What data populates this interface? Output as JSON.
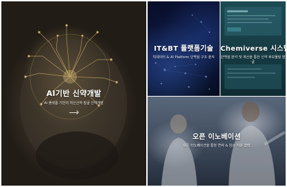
{
  "panels": {
    "ai": {
      "title": "AI기반 신약개발",
      "description": "AI 플랫폼 기반의 혁신신약 발굴 신약개발"
    },
    "itbt": {
      "title": "IT&BT 플랫폼기술",
      "description": "빅데이터 & AI Platform 단백질 구조 분석"
    },
    "chemiverse": {
      "title": "Chemiverse 시스템",
      "description": "단백질 분석 및 계산을 통한 신약 후보물질 발굴"
    },
    "open": {
      "title": "오픈 이노베이션",
      "description": "오픈 이노베이션을 통한 연자 & 임상 지원 협력"
    }
  },
  "colors": {
    "itbt_accent": "#142256",
    "chemiverse_accent": "#1d4a52",
    "text": "#ffffff"
  },
  "icons": {
    "more_link": "arrow-right-icon"
  }
}
